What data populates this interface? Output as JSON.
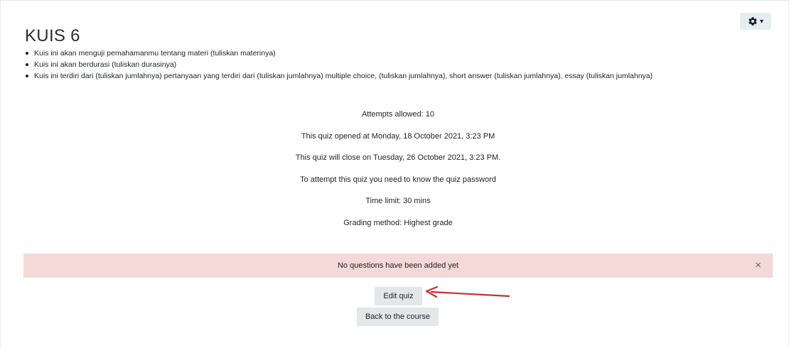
{
  "page": {
    "title": "KUIS 6",
    "settings_menu_icon": "gear-icon"
  },
  "description": {
    "items": [
      "Kuis ini akan menguji pemahamanmu tentang materi (tuliskan materinya)",
      "Kuis ini akan berdurasi (tuliskan durasinya)",
      "Kuis ini terdiri dari (tuliskan jumlahnya) pertanyaan yang terdiri dari (tuliskan jumlahnya) multiple choice, (tuliskan jumlahnya), short answer (tuliskan jumlahnya), essay (tuliskan jumlahnya)"
    ]
  },
  "quiz_info": {
    "attempts": "Attempts allowed: 10",
    "opened": "This quiz opened at Monday, 18 October 2021, 3:23 PM",
    "closes": "This quiz will close on Tuesday, 26 October 2021, 3:23 PM.",
    "password": "To attempt this quiz you need to know the quiz password",
    "time_limit": "Time limit: 30 mins",
    "grading": "Grading method: Highest grade"
  },
  "alert": {
    "message": "No questions have been added yet",
    "close_glyph": "×",
    "color": "#f5d9d8"
  },
  "buttons": {
    "edit_quiz": "Edit quiz",
    "back_to_course": "Back to the course"
  },
  "annotation": {
    "arrow_color": "#c8302e"
  }
}
